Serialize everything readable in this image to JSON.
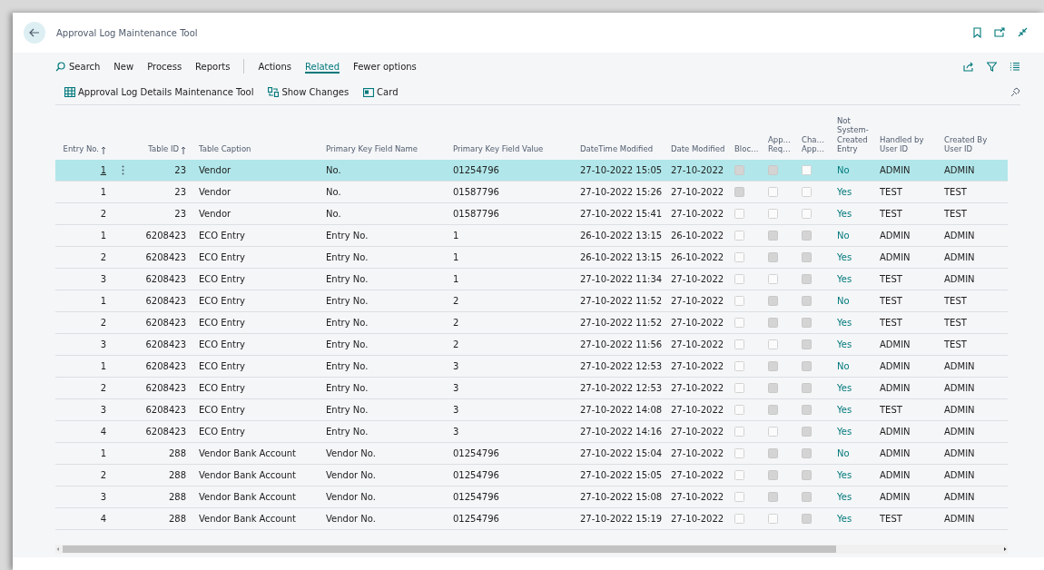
{
  "window": {
    "title": "Approval Log Maintenance Tool"
  },
  "primary_actions": [
    {
      "label": "Search",
      "kind": "search",
      "selected": false
    },
    {
      "label": "New",
      "kind": "menu",
      "selected": false
    },
    {
      "label": "Process",
      "kind": "menu",
      "selected": false
    },
    {
      "label": "Reports",
      "kind": "menu",
      "selected": false
    }
  ],
  "secondary_actions": [
    {
      "label": "Actions",
      "selected": false
    },
    {
      "label": "Related",
      "selected": true
    },
    {
      "label": "Fewer options",
      "selected": false
    }
  ],
  "related_actions": [
    {
      "label": "Approval Log Details Maintenance Tool",
      "kind": "details"
    },
    {
      "label": "Show Changes",
      "kind": "changes"
    },
    {
      "label": "Card",
      "kind": "card"
    }
  ],
  "table": {
    "columns": [
      {
        "label": "Entry No.",
        "sorted": true
      },
      {
        "label": "Table ID",
        "sorted": true
      },
      {
        "label": "Table Caption",
        "sorted": false
      },
      {
        "label": "Primary Key Field Name",
        "sorted": false
      },
      {
        "label": "Primary Key Field Value",
        "sorted": false
      },
      {
        "label": "DateTime Modified",
        "sorted": false
      },
      {
        "label": "Date Modified",
        "sorted": false
      },
      {
        "label": "Bloc…",
        "sorted": false
      },
      {
        "label": "App… Req…",
        "sorted": false
      },
      {
        "label": "Cha… App…",
        "sorted": false
      },
      {
        "label": "Not System-Created Entry",
        "sorted": false
      },
      {
        "label": "Handled by User ID",
        "sorted": false
      },
      {
        "label": "Created By User ID",
        "sorted": false
      }
    ],
    "rows": [
      {
        "entry_no": "1",
        "table_id": "23",
        "table_caption": "Vendor",
        "pk_field_name": "No.",
        "pk_field_value": "01254796",
        "datetime_modified": "27-10-2022 15:05",
        "date_modified": "27-10-2022",
        "blocked": true,
        "approval_required": true,
        "change_approved": false,
        "not_system_created": "No",
        "handled_by": "ADMIN",
        "created_by": "ADMIN",
        "selected": true
      },
      {
        "entry_no": "1",
        "table_id": "23",
        "table_caption": "Vendor",
        "pk_field_name": "No.",
        "pk_field_value": "01587796",
        "datetime_modified": "27-10-2022 15:26",
        "date_modified": "27-10-2022",
        "blocked": true,
        "approval_required": false,
        "change_approved": false,
        "not_system_created": "Yes",
        "handled_by": "TEST",
        "created_by": "TEST",
        "selected": false
      },
      {
        "entry_no": "2",
        "table_id": "23",
        "table_caption": "Vendor",
        "pk_field_name": "No.",
        "pk_field_value": "01587796",
        "datetime_modified": "27-10-2022 15:41",
        "date_modified": "27-10-2022",
        "blocked": false,
        "approval_required": false,
        "change_approved": false,
        "not_system_created": "Yes",
        "handled_by": "TEST",
        "created_by": "TEST",
        "selected": false
      },
      {
        "entry_no": "1",
        "table_id": "6208423",
        "table_caption": "ECO Entry",
        "pk_field_name": "Entry No.",
        "pk_field_value": "1",
        "datetime_modified": "26-10-2022 13:15",
        "date_modified": "26-10-2022",
        "blocked": false,
        "approval_required": true,
        "change_approved": true,
        "not_system_created": "No",
        "handled_by": "ADMIN",
        "created_by": "ADMIN",
        "selected": false
      },
      {
        "entry_no": "2",
        "table_id": "6208423",
        "table_caption": "ECO Entry",
        "pk_field_name": "Entry No.",
        "pk_field_value": "1",
        "datetime_modified": "26-10-2022 13:15",
        "date_modified": "26-10-2022",
        "blocked": false,
        "approval_required": true,
        "change_approved": true,
        "not_system_created": "Yes",
        "handled_by": "ADMIN",
        "created_by": "ADMIN",
        "selected": false
      },
      {
        "entry_no": "3",
        "table_id": "6208423",
        "table_caption": "ECO Entry",
        "pk_field_name": "Entry No.",
        "pk_field_value": "1",
        "datetime_modified": "27-10-2022 11:34",
        "date_modified": "27-10-2022",
        "blocked": false,
        "approval_required": false,
        "change_approved": true,
        "not_system_created": "Yes",
        "handled_by": "TEST",
        "created_by": "ADMIN",
        "selected": false
      },
      {
        "entry_no": "1",
        "table_id": "6208423",
        "table_caption": "ECO Entry",
        "pk_field_name": "Entry No.",
        "pk_field_value": "2",
        "datetime_modified": "27-10-2022 11:52",
        "date_modified": "27-10-2022",
        "blocked": false,
        "approval_required": true,
        "change_approved": true,
        "not_system_created": "No",
        "handled_by": "TEST",
        "created_by": "TEST",
        "selected": false
      },
      {
        "entry_no": "2",
        "table_id": "6208423",
        "table_caption": "ECO Entry",
        "pk_field_name": "Entry No.",
        "pk_field_value": "2",
        "datetime_modified": "27-10-2022 11:52",
        "date_modified": "27-10-2022",
        "blocked": false,
        "approval_required": true,
        "change_approved": true,
        "not_system_created": "Yes",
        "handled_by": "TEST",
        "created_by": "TEST",
        "selected": false
      },
      {
        "entry_no": "3",
        "table_id": "6208423",
        "table_caption": "ECO Entry",
        "pk_field_name": "Entry No.",
        "pk_field_value": "2",
        "datetime_modified": "27-10-2022 11:56",
        "date_modified": "27-10-2022",
        "blocked": false,
        "approval_required": false,
        "change_approved": true,
        "not_system_created": "Yes",
        "handled_by": "ADMIN",
        "created_by": "TEST",
        "selected": false
      },
      {
        "entry_no": "1",
        "table_id": "6208423",
        "table_caption": "ECO Entry",
        "pk_field_name": "Entry No.",
        "pk_field_value": "3",
        "datetime_modified": "27-10-2022 12:53",
        "date_modified": "27-10-2022",
        "blocked": false,
        "approval_required": true,
        "change_approved": true,
        "not_system_created": "No",
        "handled_by": "ADMIN",
        "created_by": "ADMIN",
        "selected": false
      },
      {
        "entry_no": "2",
        "table_id": "6208423",
        "table_caption": "ECO Entry",
        "pk_field_name": "Entry No.",
        "pk_field_value": "3",
        "datetime_modified": "27-10-2022 12:53",
        "date_modified": "27-10-2022",
        "blocked": false,
        "approval_required": true,
        "change_approved": true,
        "not_system_created": "Yes",
        "handled_by": "ADMIN",
        "created_by": "ADMIN",
        "selected": false
      },
      {
        "entry_no": "3",
        "table_id": "6208423",
        "table_caption": "ECO Entry",
        "pk_field_name": "Entry No.",
        "pk_field_value": "3",
        "datetime_modified": "27-10-2022 14:08",
        "date_modified": "27-10-2022",
        "blocked": false,
        "approval_required": true,
        "change_approved": true,
        "not_system_created": "Yes",
        "handled_by": "TEST",
        "created_by": "ADMIN",
        "selected": false
      },
      {
        "entry_no": "4",
        "table_id": "6208423",
        "table_caption": "ECO Entry",
        "pk_field_name": "Entry No.",
        "pk_field_value": "3",
        "datetime_modified": "27-10-2022 14:16",
        "date_modified": "27-10-2022",
        "blocked": false,
        "approval_required": false,
        "change_approved": true,
        "not_system_created": "Yes",
        "handled_by": "ADMIN",
        "created_by": "ADMIN",
        "selected": false
      },
      {
        "entry_no": "1",
        "table_id": "288",
        "table_caption": "Vendor Bank Account",
        "pk_field_name": "Vendor No.",
        "pk_field_value": "01254796",
        "datetime_modified": "27-10-2022 15:04",
        "date_modified": "27-10-2022",
        "blocked": false,
        "approval_required": true,
        "change_approved": true,
        "not_system_created": "No",
        "handled_by": "ADMIN",
        "created_by": "ADMIN",
        "selected": false
      },
      {
        "entry_no": "2",
        "table_id": "288",
        "table_caption": "Vendor Bank Account",
        "pk_field_name": "Vendor No.",
        "pk_field_value": "01254796",
        "datetime_modified": "27-10-2022 15:05",
        "date_modified": "27-10-2022",
        "blocked": false,
        "approval_required": true,
        "change_approved": true,
        "not_system_created": "Yes",
        "handled_by": "ADMIN",
        "created_by": "ADMIN",
        "selected": false
      },
      {
        "entry_no": "3",
        "table_id": "288",
        "table_caption": "Vendor Bank Account",
        "pk_field_name": "Vendor No.",
        "pk_field_value": "01254796",
        "datetime_modified": "27-10-2022 15:08",
        "date_modified": "27-10-2022",
        "blocked": false,
        "approval_required": true,
        "change_approved": true,
        "not_system_created": "Yes",
        "handled_by": "ADMIN",
        "created_by": "ADMIN",
        "selected": false
      },
      {
        "entry_no": "4",
        "table_id": "288",
        "table_caption": "Vendor Bank Account",
        "pk_field_name": "Vendor No.",
        "pk_field_value": "01254796",
        "datetime_modified": "27-10-2022 15:19",
        "date_modified": "27-10-2022",
        "blocked": false,
        "approval_required": false,
        "change_approved": true,
        "not_system_created": "Yes",
        "handled_by": "TEST",
        "created_by": "ADMIN",
        "selected": false
      }
    ]
  }
}
